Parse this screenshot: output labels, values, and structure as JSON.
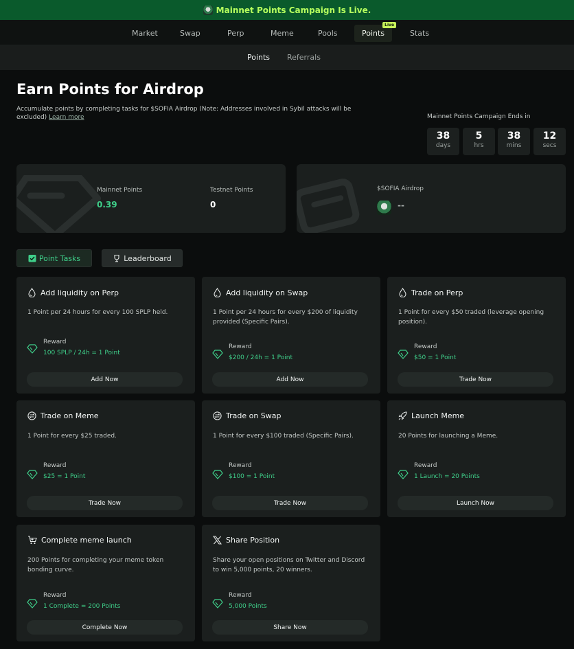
{
  "banner": {
    "text": "Mainnet Points Campaign Is Live."
  },
  "nav": {
    "items": [
      {
        "label": "Market"
      },
      {
        "label": "Swap"
      },
      {
        "label": "Perp"
      },
      {
        "label": "Meme"
      },
      {
        "label": "Pools"
      },
      {
        "label": "Points",
        "badge": "Live"
      },
      {
        "label": "Stats"
      }
    ]
  },
  "subnav": {
    "items": [
      {
        "label": "Points"
      },
      {
        "label": "Referrals"
      }
    ]
  },
  "header": {
    "title": "Earn Points for Airdrop",
    "description": "Accumulate points by completing tasks for $SOFIA Airdrop (Note: Addresses involved in Sybil attacks will be excluded)",
    "learn_more": "Learn more"
  },
  "countdown": {
    "title": "Mainnet Points Campaign Ends in",
    "days": "38",
    "days_label": "days",
    "hours": "5",
    "hours_label": "hrs",
    "mins": "38",
    "mins_label": "mins",
    "secs": "12",
    "secs_label": "secs"
  },
  "stats": {
    "mainnet_label": "Mainnet Points",
    "mainnet_value": "0.39",
    "testnet_label": "Testnet Points",
    "testnet_value": "0",
    "airdrop_label": "$SOFIA Airdrop",
    "airdrop_value": "--"
  },
  "tabs": {
    "point_tasks": "Point Tasks",
    "leaderboard": "Leaderboard"
  },
  "tasks": [
    {
      "title": "Add liquidity on Perp",
      "desc": "1 Point per 24 hours for every 100 SPLP held.",
      "reward_label": "Reward",
      "reward": "100 SPLP / 24h = 1 Point",
      "button": "Add Now"
    },
    {
      "title": "Add liquidity on Swap",
      "desc": "1 Point per 24 hours for every $200 of liquidity provided (Specific Pairs).",
      "reward_label": "Reward",
      "reward": "$200 / 24h = 1 Point",
      "button": "Add Now"
    },
    {
      "title": "Trade on Perp",
      "desc": "1 Point for every $50 traded (leverage opening position).",
      "reward_label": "Reward",
      "reward": "$50 = 1 Point",
      "button": "Trade Now"
    },
    {
      "title": "Trade on Meme",
      "desc": "1 Point for every $25 traded.",
      "reward_label": "Reward",
      "reward": "$25 = 1 Point",
      "button": "Trade Now"
    },
    {
      "title": "Trade on Swap",
      "desc": "1 Point for every $100 traded (Specific Pairs).",
      "reward_label": "Reward",
      "reward": "$100 = 1 Point",
      "button": "Trade Now"
    },
    {
      "title": "Launch Meme",
      "desc": "20 Points for launching a Meme.",
      "reward_label": "Reward",
      "reward": "1 Launch = 20 Points",
      "button": "Launch Now"
    },
    {
      "title": "Complete meme launch",
      "desc": "200 Points for completing your meme token bonding curve.",
      "reward_label": "Reward",
      "reward": "1 Complete = 200 Points",
      "button": "Complete Now"
    },
    {
      "title": "Share Position",
      "desc": "Share your open positions on Twitter and Discord to win 5,000 points, 20 winners.",
      "reward_label": "Reward",
      "reward": "5,000 Points",
      "button": "Share Now"
    }
  ],
  "colors": {
    "accent_green": "#3fcf8a",
    "banner_bg": "#0a5a2c",
    "banner_text": "#b6ff5e",
    "live_badge": "#c7f25a"
  }
}
